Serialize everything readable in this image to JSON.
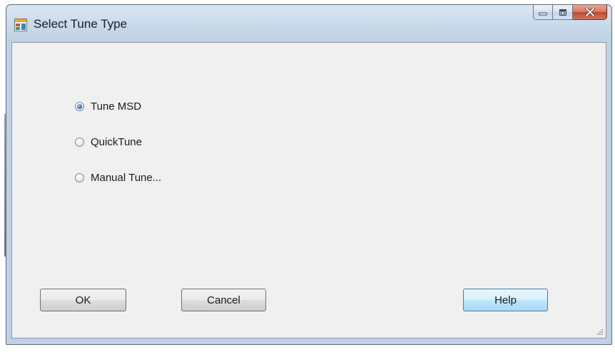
{
  "window": {
    "title": "Select Tune Type",
    "icon": "app-window-icon"
  },
  "caption_buttons": {
    "minimize": "minimize-icon",
    "maximize": "maximize-icon",
    "close": "close-icon"
  },
  "tune_options": [
    {
      "label": "Tune MSD",
      "checked": true
    },
    {
      "label": "QuickTune",
      "checked": false
    },
    {
      "label": "Manual Tune...",
      "checked": false
    }
  ],
  "buttons": {
    "ok": "OK",
    "cancel": "Cancel",
    "help": "Help"
  },
  "colors": {
    "title_bar": "#c9d9ea",
    "client_background": "#f0f0f0",
    "close_button": "#c0442b",
    "radio_selected": "#2e6cc4"
  }
}
